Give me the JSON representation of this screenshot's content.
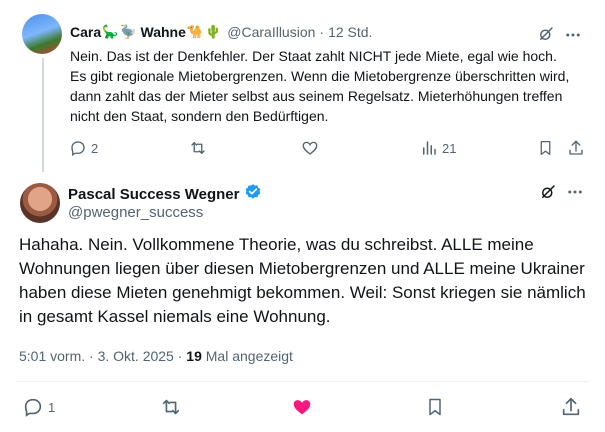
{
  "reply": {
    "name": "Cara",
    "name_part2": "Wahne",
    "emojis": [
      "🦕",
      "🦤",
      "🐪",
      "🌵"
    ],
    "handle": "@CaraIllusion",
    "time": "12 Std.",
    "text": "Nein. Das ist der Denkfehler. Der Staat zahlt NICHT jede Miete, egal wie hoch. Es gibt regionale Mietobergrenzen. Wenn die Mietobergrenze überschritten wird, dann zahlt das der Mieter selbst aus seinem Regelsatz. Mieterhöhungen treffen nicht den Staat, sondern den Bedürftigen.",
    "actions": {
      "replies": "2",
      "views": "21"
    }
  },
  "main": {
    "name": "Pascal Success Wegner",
    "handle": "@pwegner_success",
    "text": "Hahaha. Nein. Vollkommene Theorie, was du schreibst. ALLE meine Wohnungen liegen über diesen Mietobergrenzen und ALLE meine Ukrainer haben diese Mieten genehmigt bekommen. Weil: Sonst kriegen sie nämlich in gesamt Kassel niemals eine Wohnung.",
    "timestamp": "5:01 vorm. · 3. Okt. 2025 ·",
    "views_count": "19",
    "views_label": "Mal angezeigt",
    "actions": {
      "replies": "1"
    }
  },
  "colors": {
    "muted": "#536471",
    "like_active": "#f91880",
    "verified": "#1d9bf0",
    "thread_line": "#cfd9de"
  },
  "icons": [
    "grok-icon",
    "more-icon",
    "reply-icon",
    "retweet-icon",
    "like-icon",
    "views-icon",
    "bookmark-icon",
    "share-icon",
    "verified-badge-icon"
  ]
}
